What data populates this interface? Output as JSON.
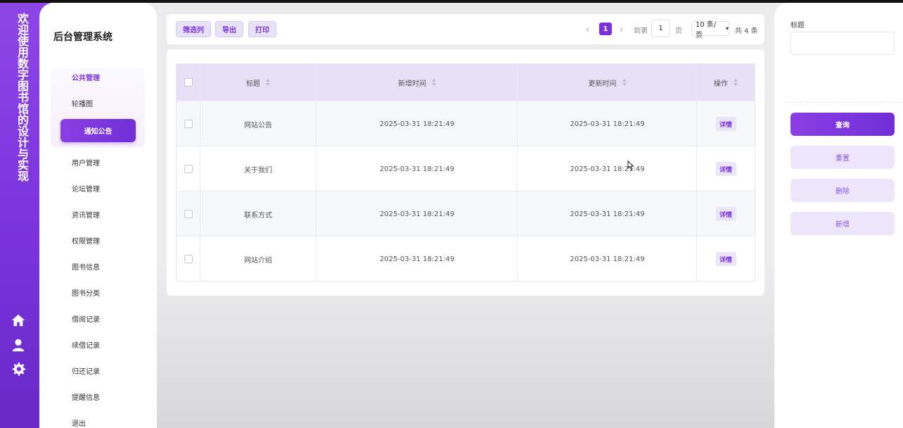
{
  "rail": {
    "title": "欢迎使用数字图书馆的设计与实现",
    "icons": [
      "home-icon",
      "user-icon",
      "gear-icon"
    ],
    "color": "#7a33dc"
  },
  "menu": {
    "brand": "后台管理系统",
    "group_title": "公共管理",
    "group_items": [
      "轮播图",
      "通知公告"
    ],
    "active": "通知公告",
    "items": [
      "用户管理",
      "论坛管理",
      "资讯管理",
      "权限管理",
      "图书信息",
      "图书分类",
      "借阅记录",
      "续借记录",
      "归还记录",
      "提醒信息",
      "退出"
    ]
  },
  "toolbar": {
    "filter_label": "筛选列",
    "export_label": "导出",
    "print_label": "打印"
  },
  "pagination": {
    "prev": "‹",
    "current": "1",
    "next": "›",
    "goto_label": "到第",
    "page_input": "1",
    "page_suffix": "页",
    "page_size": "10 条/页",
    "total": "共 4 条"
  },
  "table": {
    "columns": [
      "标题",
      "新增时间",
      "更新时间",
      "操作"
    ],
    "rows": [
      {
        "title": "网站公告",
        "created": "2025-03-31 18:21:49",
        "updated": "2025-03-31 18:21:49",
        "action": "详情"
      },
      {
        "title": "关于我们",
        "created": "2025-03-31 18:21:49",
        "updated": "2025-03-31 18:21:49",
        "action": "详情"
      },
      {
        "title": "联系方式",
        "created": "2025-03-31 18:21:49",
        "updated": "2025-03-31 18:21:49",
        "action": "详情"
      },
      {
        "title": "网站介绍",
        "created": "2025-03-31 18:21:49",
        "updated": "2025-03-31 18:21:49",
        "action": "详情"
      }
    ]
  },
  "search": {
    "title_label": "标题",
    "title_value": "",
    "query_label": "查询",
    "reset_label": "重置",
    "delete_label": "删除",
    "add_label": "新增"
  },
  "colors": {
    "accent": "#7a33dc",
    "accent_light": "#ede6fb",
    "header_bg": "#e8e0f7"
  }
}
